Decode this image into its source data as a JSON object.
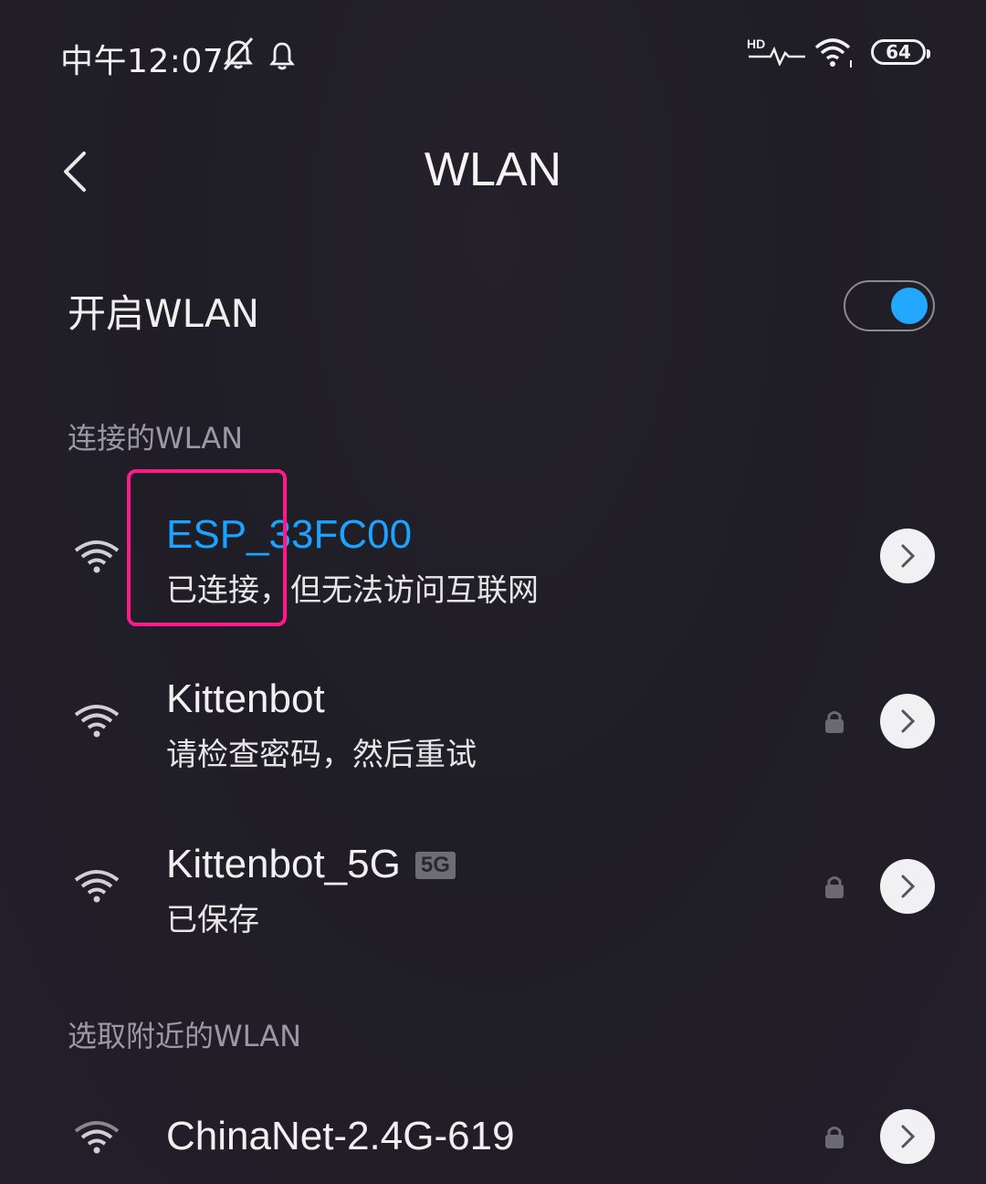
{
  "status_bar": {
    "time": "中午12:07",
    "network_type": "HD",
    "battery": "64",
    "icons": [
      "alarm-off-icon",
      "notification-bell-icon",
      "hd-signal-icon",
      "wifi-icon",
      "battery-icon"
    ]
  },
  "header": {
    "title": "WLAN",
    "back_icon": "chevron-left-icon"
  },
  "wlan_toggle": {
    "label": "开启WLAN",
    "enabled": true,
    "accent_color": "#22a8ff"
  },
  "connected_section": {
    "title": "连接的WLAN",
    "networks": [
      {
        "name": "ESP_33FC00",
        "status": "已连接，但无法访问互联网",
        "locked": false,
        "highlighted": true
      }
    ]
  },
  "saved_networks": [
    {
      "name": "Kittenbot",
      "status": "请检查密码，然后重试",
      "locked": true
    },
    {
      "name": "Kittenbot_5G",
      "badge": "5G",
      "status": "已保存",
      "locked": true
    }
  ],
  "nearby_section": {
    "title": "选取附近的WLAN",
    "networks": [
      {
        "name": "ChinaNet-2.4G-619",
        "locked": true
      }
    ]
  },
  "colors": {
    "connected_text": "#1aa3ff",
    "highlight_box": "#ff1a8c"
  }
}
